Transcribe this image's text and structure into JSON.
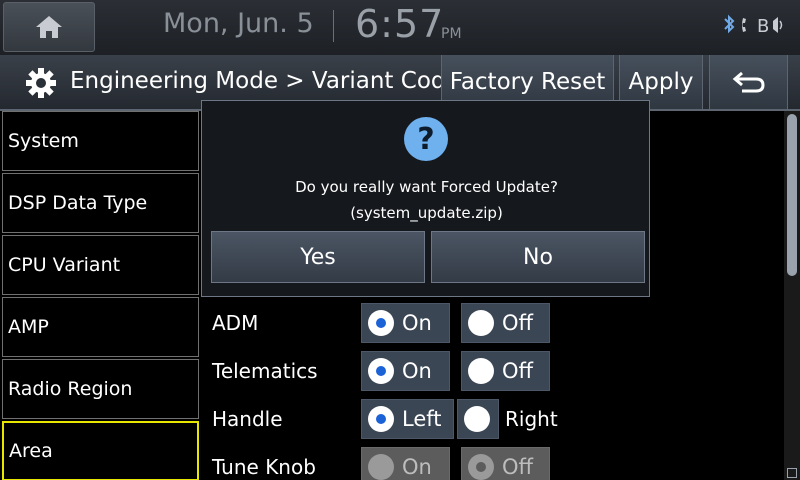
{
  "status": {
    "date": "Mon, Jun. 5",
    "time": "6:57",
    "ampm": "PM",
    "icons": [
      "home-icon",
      "bluetooth-icon",
      "call-icon",
      "bluetooth-audio-icon"
    ]
  },
  "header": {
    "title": "Engineering Mode > Variant Coding",
    "factory_reset": "Factory Reset",
    "apply": "Apply"
  },
  "sidebar": {
    "items": [
      {
        "label": "System"
      },
      {
        "label": "DSP Data Type"
      },
      {
        "label": "CPU Variant"
      },
      {
        "label": "AMP"
      },
      {
        "label": "Radio Region"
      },
      {
        "label": "Area"
      }
    ]
  },
  "options": [
    {
      "label": "ADM",
      "a": "On",
      "b": "Off",
      "selected": "a"
    },
    {
      "label": "Telematics",
      "a": "On",
      "b": "Off",
      "selected": "a"
    },
    {
      "label": "Handle",
      "a": "Left",
      "b": "Right",
      "selected": "a"
    },
    {
      "label": "Tune Knob",
      "a": "On",
      "b": "Off",
      "selected": "b",
      "disabled": true
    }
  ],
  "dialog": {
    "icon": "?",
    "message": "Do you really want Forced Update?",
    "filename": "(system_update.zip)",
    "yes": "Yes",
    "no": "No"
  },
  "colors": {
    "accent_selected": "#1a62d6",
    "active_border": "#e6e600",
    "question_icon": "#6fb0ee"
  }
}
